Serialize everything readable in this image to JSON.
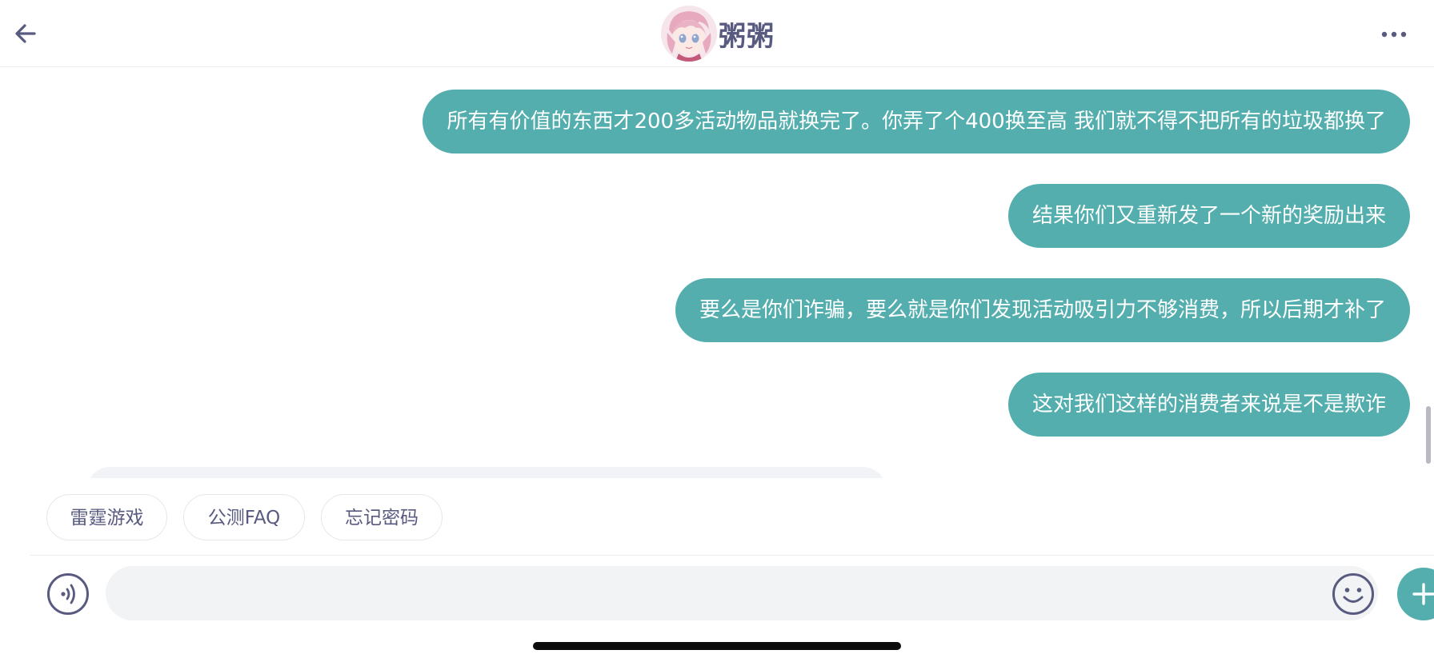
{
  "header": {
    "title": "粥粥",
    "back_icon": "arrow-left-icon",
    "more_icon": "more-horizontal-icon",
    "avatar": "anime-character-avatar"
  },
  "messages": [
    {
      "sender": "self",
      "text": "所有有价值的东西才200多活动物品就换完了。你弄了个400换至高 我们就不得不把所有的垃圾都换了"
    },
    {
      "sender": "self",
      "text": "结果你们又重新发了一个新的奖励出来"
    },
    {
      "sender": "self",
      "text": "要么是你们诈骗，要么就是你们发现活动吸引力不够消费，所以后期才补了"
    },
    {
      "sender": "self",
      "text": "这对我们这样的消费者来说是不是欺诈"
    }
  ],
  "quick_replies": [
    "雷霆游戏",
    "公测FAQ",
    "忘记密码"
  ],
  "input_bar": {
    "placeholder": "",
    "value": "",
    "voice_icon": "voice-wave-icon",
    "emoji_icon": "smiley-icon",
    "plus_icon": "plus-icon"
  },
  "colors": {
    "bubble": "#54aeae",
    "header_text": "#585a80",
    "chip_text": "#585a80",
    "input_bg": "#f2f3f5"
  }
}
